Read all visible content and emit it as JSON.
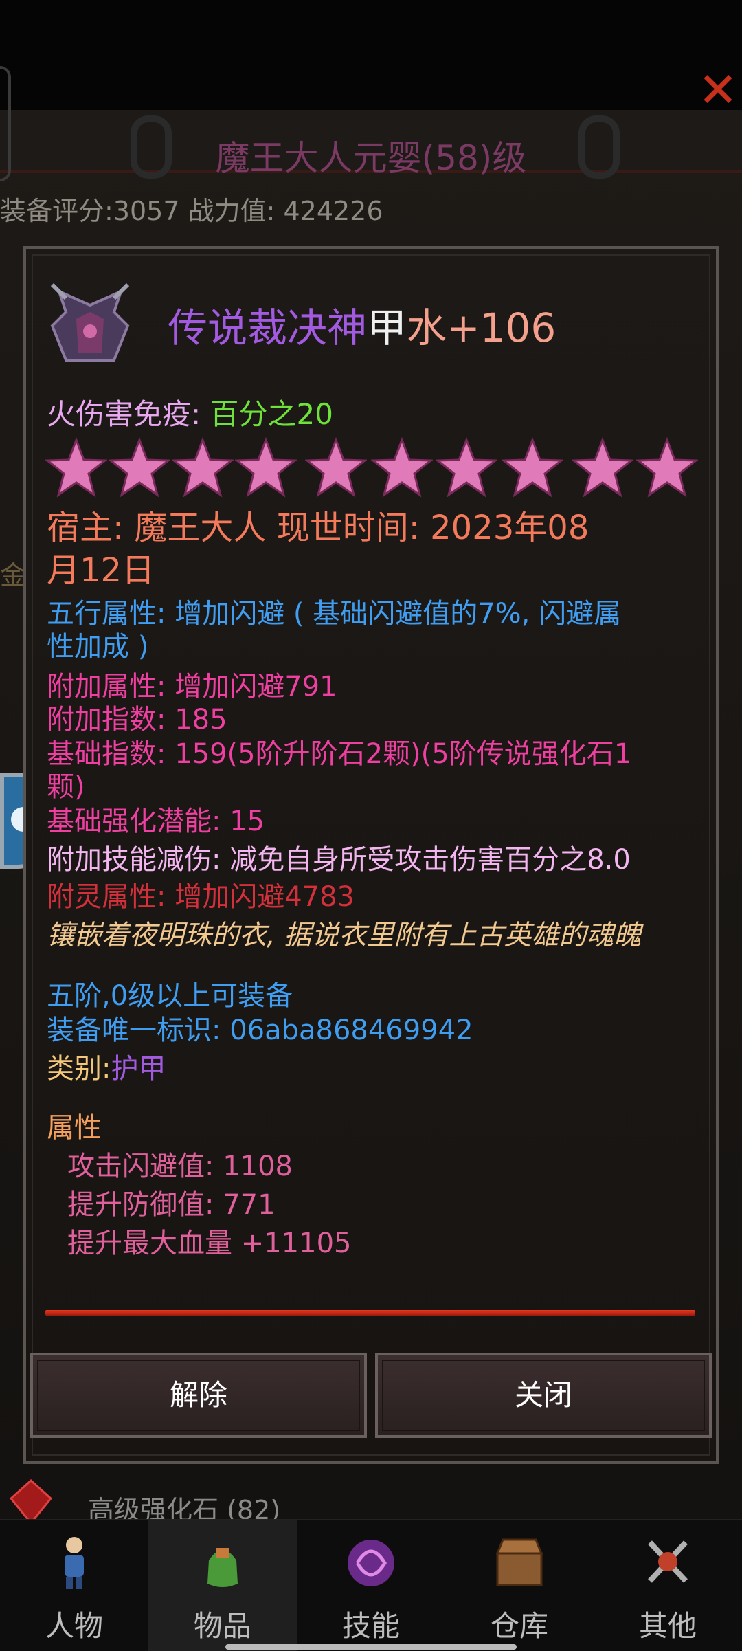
{
  "header": {
    "title": "魔王大人元婴(58)级",
    "score_line": "装备评分:3057  战力值:  424226",
    "close_glyph": "✕",
    "side_char": "金"
  },
  "item": {
    "name_part1": "传说裁决神",
    "name_part2": "甲",
    "name_part3": "水+106",
    "colors": {
      "name_purple": "#a25be0",
      "name_white": "#f0f0f0",
      "name_peach": "#f4a08c"
    },
    "star_count": 10,
    "immunity_label": "火伤害免疫:",
    "immunity_value": "百分之20",
    "owner_line1": "宿主:  魔王大人  现世时间:  2023年08",
    "owner_line2": "月12日",
    "element_line1": "五行属性:  增加闪避 ( 基础闪避值的7%,  闪避属",
    "element_line2": "性加成 )",
    "extra_attr": "附加属性:  增加闪避791",
    "extra_index": "附加指数:  185",
    "base_index_line1": "基础指数:  159(5阶升阶石2颗)(5阶传说强化石1",
    "base_index_line2": "颗)",
    "base_potential": "基础强化潜能:  15",
    "skill_reduce": "附加技能减伤:  减免自身所受攻击伤害百分之8.0",
    "spirit_attr": "附灵属性:  增加闪避4783",
    "flavor": "镶嵌着夜明珠的衣,  据说衣里附有上古英雄的魂魄",
    "requirement": "五阶,0级以上可装备",
    "unique_id": "装备唯一标识:  06aba868469942",
    "category_label": "类别:",
    "category_value": "护甲",
    "attr_header": "属性",
    "attrs": [
      "攻击闪避值:  1108",
      "提升防御值:  771",
      "提升最大血量  +11105"
    ]
  },
  "buttons": {
    "unequip": "解除",
    "close": "关闭"
  },
  "below": {
    "item_label": "高级强化石  (82)"
  },
  "nav": {
    "items": [
      {
        "label": "人物",
        "icon": "character-icon"
      },
      {
        "label": "物品",
        "icon": "items-icon"
      },
      {
        "label": "技能",
        "icon": "skills-icon"
      },
      {
        "label": "仓库",
        "icon": "warehouse-icon"
      },
      {
        "label": "其他",
        "icon": "other-icon"
      }
    ],
    "active_index": 1
  }
}
